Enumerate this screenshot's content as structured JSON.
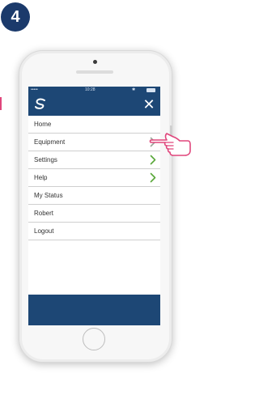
{
  "step": {
    "number": "4"
  },
  "statusbar": {
    "dots": "•••••",
    "time": "10:28",
    "bt": "✱"
  },
  "header": {
    "logo_icon": "swirl-logo-icon",
    "close_icon": "close-icon",
    "close_symbol": "✕"
  },
  "menu": {
    "items": [
      {
        "label": "Home",
        "chevron": false
      },
      {
        "label": "Equipment",
        "chevron": true,
        "chevron_color": "#9aa89a"
      },
      {
        "label": "Settings",
        "chevron": true,
        "chevron_color": "#5aa83a"
      },
      {
        "label": "Help",
        "chevron": true,
        "chevron_color": "#5aa83a"
      },
      {
        "label": "My Status",
        "chevron": false
      },
      {
        "label": "Robert",
        "chevron": false
      },
      {
        "label": "Logout",
        "chevron": false
      }
    ]
  },
  "colors": {
    "header_blue": "#1d4775",
    "badge_navy": "#1b3a6b",
    "chevron_green": "#5aa83a",
    "pointer_pink": "#e0467c"
  },
  "pointer": {
    "icon": "pointing-hand-icon"
  }
}
